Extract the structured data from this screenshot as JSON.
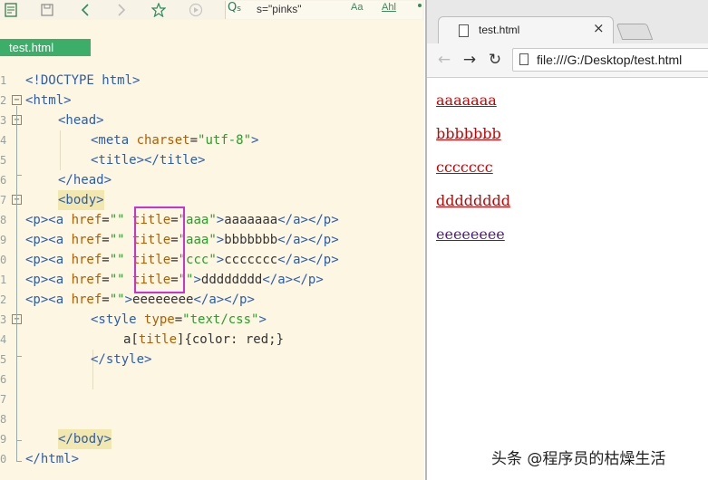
{
  "editor": {
    "search_text": "s=\"pinks\"",
    "tab_name": "test.html",
    "line_numbers": [
      "1",
      "2",
      "3",
      "4",
      "5",
      "6",
      "7",
      "8",
      "9",
      "0",
      "1",
      "2",
      "3",
      "4",
      "5",
      "6",
      "7",
      "8",
      "9",
      "0"
    ],
    "code": {
      "l1": "<!DOCTYPE html>",
      "l2_open": "<",
      "l2_tag": "html",
      "l2_close": ">",
      "head_open": "<head>",
      "meta_tag": "<meta ",
      "meta_attr": "charset",
      "eq": "=",
      "meta_val": "\"utf-8\"",
      "meta_end": ">",
      "title_line": "<title></title>",
      "head_close": "</head>",
      "body_open": "<body>",
      "p_open": "<p><a ",
      "href": "href",
      "empty": "\"\"",
      "sp": " ",
      "title_attr": "title",
      "aaa": "\"aaa\"",
      "ccc": "\"ccc\"",
      "gt": ">",
      "end": "</a></p>",
      "txt1": "aaaaaaa",
      "txt2": "bbbbbbb",
      "txt3": "ccccccc",
      "txt4": "dddddddd",
      "txt5": "eeeeeeee",
      "style_open": "<style ",
      "type_attr": "type",
      "type_val": "\"text/css\"",
      "css_sel": "a[",
      "css_attr": "title",
      "css_rest": "]{color: red;}",
      "style_close": "</style>",
      "body_close": "</body>",
      "html_close": "</html>"
    }
  },
  "browser": {
    "tab_title": "test.html",
    "tab_close": "×",
    "back": "←",
    "forward": "→",
    "reload": "↻",
    "address": "file:///G:/Desktop/test.html",
    "links": [
      {
        "text": "aaaaaaa",
        "color": "#cc0000"
      },
      {
        "text": "bbbbbbb",
        "color": "#cc0000"
      },
      {
        "text": "ccccccc",
        "color": "#cc0000"
      },
      {
        "text": "dddddddd",
        "color": "#cc0000"
      },
      {
        "text": "eeeeeeee",
        "color": "#551a8b"
      }
    ]
  },
  "watermark": "头条 @程序员的枯燥生活",
  "icons": [
    "document-icon",
    "save-icon",
    "back-arrow-icon",
    "forward-arrow-icon",
    "star-icon",
    "play-icon",
    "search-icon",
    "font-icon",
    "letter-case-icon"
  ]
}
